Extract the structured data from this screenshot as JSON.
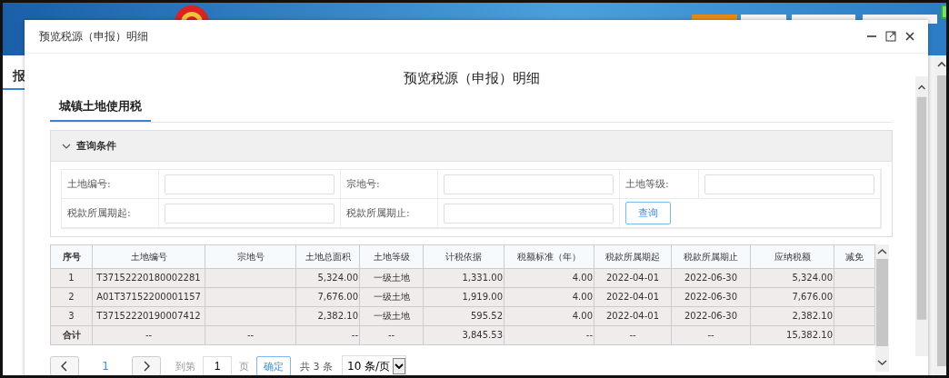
{
  "background": {
    "side_tab": "报"
  },
  "dialog": {
    "title": "预览税源（申报）明细"
  },
  "heading": "预览税源（申报）明细",
  "tabs": [
    {
      "label": "城镇土地使用税",
      "selected": true
    }
  ],
  "query": {
    "title": "查询条件",
    "expanded": true,
    "fields": [
      {
        "label": "土地编号:"
      },
      {
        "label": "宗地号:"
      },
      {
        "label": "土地等级:"
      },
      {
        "label": "税款所属期起:"
      },
      {
        "label": "税款所属期止:"
      }
    ],
    "button": "查询"
  },
  "table": {
    "columns": [
      {
        "label": "序号"
      },
      {
        "label": "土地编号"
      },
      {
        "label": "宗地号"
      },
      {
        "label": "土地总面积"
      },
      {
        "label": "土地等级"
      },
      {
        "label": "计税依据"
      },
      {
        "label": "税额标准（年）"
      },
      {
        "label": "税款所属期起"
      },
      {
        "label": "税款所属期止"
      },
      {
        "label": "应纳税额"
      },
      {
        "label": "减免"
      }
    ],
    "rows": [
      {
        "cells": [
          "1",
          "T37152220180002281",
          "",
          "5,324.00",
          "一级土地",
          "1,331.00",
          "4.00",
          "2022-04-01",
          "2022-06-30",
          "5,324.00"
        ]
      },
      {
        "cells": [
          "2",
          "A01T37152200001157",
          "",
          "7,676.00",
          "一级土地",
          "1,919.00",
          "4.00",
          "2022-04-01",
          "2022-06-30",
          "7,676.00"
        ]
      },
      {
        "cells": [
          "3",
          "T37152220190007412",
          "",
          "2,382.10",
          "一级土地",
          "595.52",
          "4.00",
          "2022-04-01",
          "2022-06-30",
          "2,382.10"
        ]
      }
    ],
    "total": {
      "cells": [
        "合计",
        "--",
        "--",
        "--",
        "--",
        "3,845.53",
        "--",
        "--",
        "--",
        "15,382.10"
      ]
    }
  },
  "pagination": {
    "pages": [
      {
        "label": "1",
        "selected": true
      }
    ],
    "goto_label": "到第",
    "page_value": "1",
    "page_unit": "页",
    "confirm": "确定",
    "count": "共 3 条",
    "page_size": "10 条/页"
  }
}
